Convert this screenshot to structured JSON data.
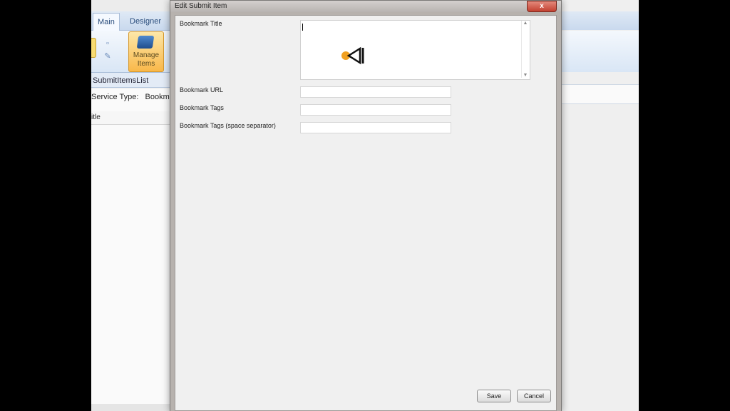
{
  "app": {
    "tabs": [
      {
        "label": "Main"
      },
      {
        "label": "Designer"
      }
    ],
    "ribbon": {
      "manage_items_label": "Manage Items"
    },
    "document_tab": "SubmitItemsList",
    "service_type_label": "Service Type:",
    "service_type_value": "Bookmar",
    "grid_column_header": "itle"
  },
  "dialog": {
    "title": "Edit Submit Item",
    "close_label": "x",
    "fields": [
      {
        "label": "Bookmark Title",
        "value": ""
      },
      {
        "label": "Bookmark URL",
        "value": ""
      },
      {
        "label": "Bookmark Tags",
        "value": ""
      },
      {
        "label": "Bookmark Tags (space separator)",
        "value": ""
      }
    ],
    "save_label": "Save",
    "cancel_label": "Cancel"
  },
  "icons": {
    "speaker": "speaker-mute-icon",
    "manage": "book-icon"
  },
  "colors": {
    "ribbon_accent": "#c9d9ee",
    "manage_button": "#f9b84a",
    "close_button": "#c24030"
  }
}
